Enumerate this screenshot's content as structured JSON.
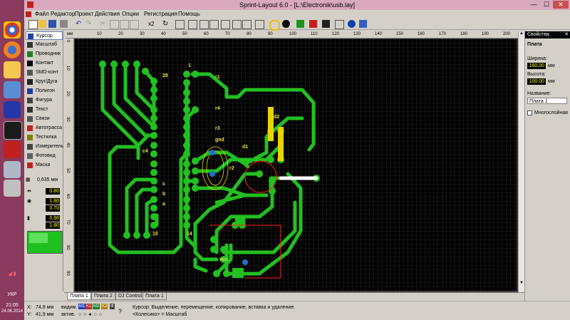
{
  "window": {
    "title": "Sprint-Layout 6.0 - [L:\\Electronik\\usb.lay]",
    "minimize": "—",
    "maximize": "☐",
    "close": "✕"
  },
  "menu": [
    "Файл",
    "Редактор",
    "Проект",
    "Действия",
    "Опции",
    "Регистрация",
    "Помощь"
  ],
  "toolbar": {
    "repeat_label": "x2"
  },
  "tools": [
    {
      "label": "Курсор",
      "icon": "cursor-icon",
      "active": true
    },
    {
      "label": "Масштаб",
      "icon": "zoom-icon"
    },
    {
      "label": "Проводник",
      "icon": "track-icon"
    },
    {
      "label": "Контакт",
      "icon": "pad-icon"
    },
    {
      "label": "SMD-конт",
      "icon": "smd-pad-icon"
    },
    {
      "label": "Круг/Дуга",
      "icon": "circle-arc-icon"
    },
    {
      "label": "Полигон",
      "icon": "polygon-icon"
    },
    {
      "label": "Фигура",
      "icon": "shape-icon"
    },
    {
      "label": "Текст",
      "icon": "text-icon"
    },
    {
      "label": "Связи",
      "icon": "connections-icon"
    },
    {
      "label": "Автотрасса",
      "icon": "autoroute-icon"
    },
    {
      "label": "Тестилка",
      "icon": "tester-icon"
    },
    {
      "label": "Измеритель",
      "icon": "measure-icon"
    },
    {
      "label": "Фотовид",
      "icon": "photoview-icon"
    },
    {
      "label": "Маска",
      "icon": "mask-icon"
    }
  ],
  "grid_value": "0,635 мм",
  "track_width": "0.80",
  "pad_outer": "1.80",
  "pad_inner": "0.70",
  "smd_w": "0.90",
  "smd_h": "1.80",
  "ruler_unit": "мм",
  "ruler_top": [
    "10",
    "20",
    "30",
    "40",
    "50",
    "60",
    "70",
    "80",
    "90",
    "100",
    "110",
    "120",
    "130",
    "140",
    "150",
    "160",
    "170",
    "180",
    "190",
    "200"
  ],
  "ruler_left": [
    "0",
    "10",
    "20",
    "30",
    "40",
    "50",
    "60",
    "70",
    "80",
    "90"
  ],
  "properties": {
    "title": "Свойства",
    "section": "Плата",
    "width_label": "Ширина:",
    "width_value": "160.00",
    "height_label": "Высота:",
    "height_value": "100.00",
    "unit": "мм",
    "name_label": "Название:",
    "name_value": "Плата 1",
    "multilayer_label": "Многослойная",
    "multilayer_checked": false
  },
  "tabs": [
    "Плата 1",
    "Плата 2",
    "DJ Control1",
    "Плата 1"
  ],
  "status": {
    "x_label": "X:",
    "x_value": "74,8 мм",
    "y_label": "Y:",
    "y_value": "41,9 мм",
    "visible_label": "видим.",
    "active_label": "актив.",
    "layers": [
      "M1",
      "K1",
      "M2",
      "K2",
      "Ф"
    ],
    "message": "Курсор: Выделение, перемещение, копирование, вставка и удаление.",
    "hint": "<Колесико> = Масштаб"
  },
  "taskbar": {
    "lang": "УКР",
    "time": "21:05",
    "date": "24.06.2014"
  },
  "pcb_labels": [
    "28",
    "1",
    "15",
    "14",
    "c4",
    "c",
    "b",
    "a",
    "d1",
    "d2",
    "gnd",
    "vcc",
    "r1",
    "r2",
    "r3",
    "r4"
  ],
  "colors": {
    "track": "#22c020",
    "silk": "#ffff40",
    "window_title": "#d9a9bd",
    "taskbar": "#8a3a5c",
    "canvas": "#000000"
  }
}
